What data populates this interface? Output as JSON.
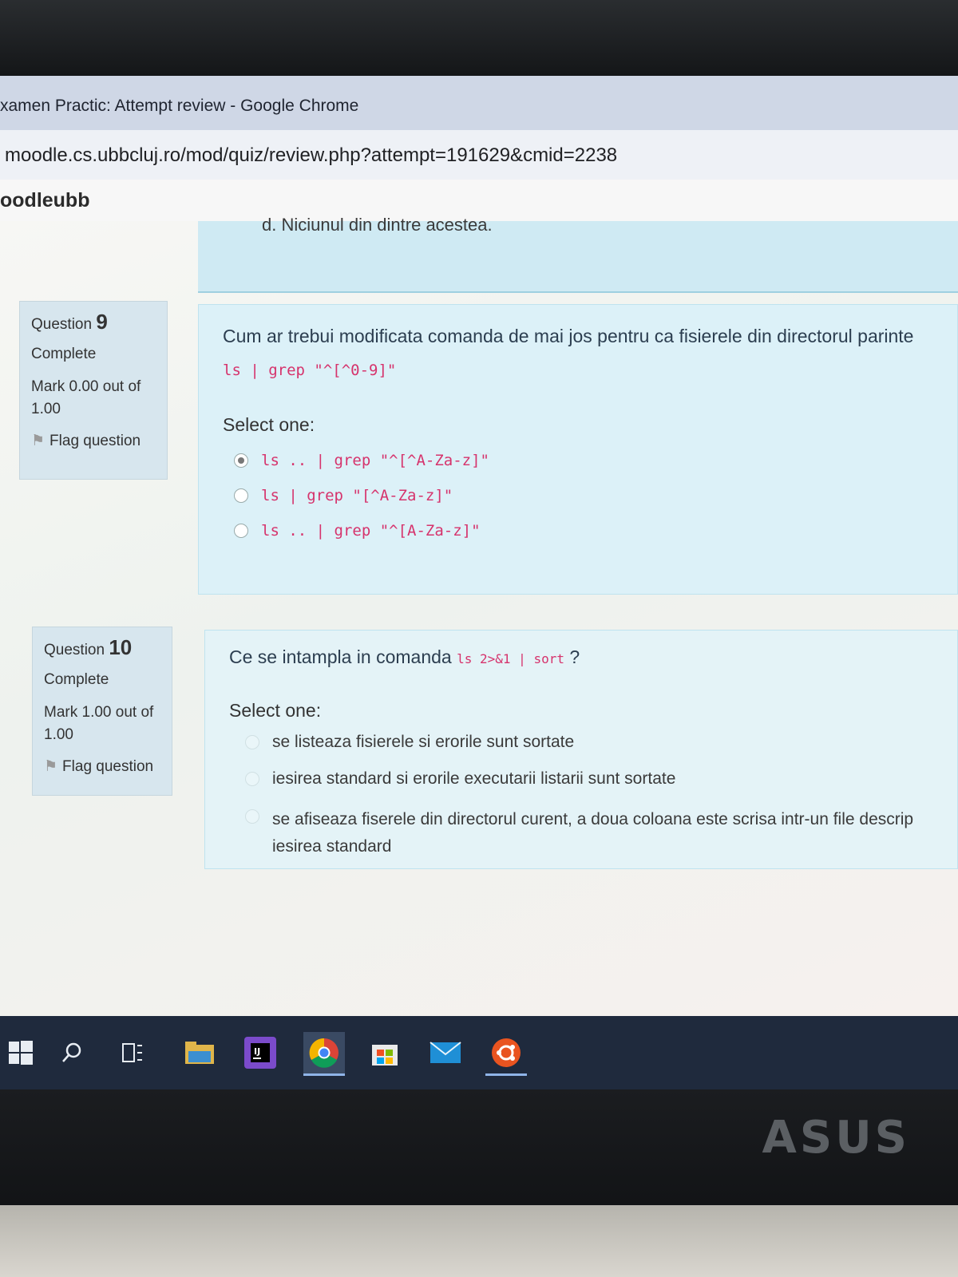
{
  "browser": {
    "window_title": "xamen Practic: Attempt review - Google Chrome",
    "url": "moodle.cs.ubbcluj.ro/mod/quiz/review.php?attempt=191629&cmid=2238"
  },
  "site": {
    "brand": "oodleubb"
  },
  "previous_question": {
    "last_option_text": "d. Niciunul din dintre acestea."
  },
  "questions": [
    {
      "label": "Question",
      "number": "9",
      "state": "Complete",
      "grade": "Mark 0.00 out of 1.00",
      "flag_label": "Flag question",
      "text": "Cum ar trebui modificata comanda de mai jos pentru ca fisierele din directorul parinte",
      "code": "ls | grep \"^[^0-9]\"",
      "prompt": "Select one:",
      "answers": [
        {
          "text": "ls .. | grep \"^[^A-Za-z]\"",
          "selected": true
        },
        {
          "text": "ls | grep \"[^A-Za-z]\"",
          "selected": false
        },
        {
          "text": "ls .. | grep \"^[A-Za-z]\"",
          "selected": false
        }
      ]
    },
    {
      "label": "Question",
      "number": "10",
      "state": "Complete",
      "grade": "Mark 1.00 out of 1.00",
      "flag_label": "Flag question",
      "text_before": "Ce se intampla in comanda",
      "code": "ls 2>&1 | sort",
      "text_after": "?",
      "prompt": "Select one:",
      "answers": [
        {
          "text": "se listeaza fisierele si erorile sunt sortate",
          "selected": false
        },
        {
          "text": "iesirea standard si erorile executarii listarii sunt sortate",
          "selected": false
        },
        {
          "text": "se afiseaza fiserele din directorul curent, a doua coloana este scrisa intr-un file descrip iesirea standard",
          "selected": false
        }
      ]
    }
  ],
  "taskbar": {
    "icons": [
      "windows-start-icon",
      "search-icon",
      "task-view-icon",
      "file-explorer-icon",
      "intellij-icon",
      "chrome-icon",
      "store-icon",
      "mail-icon",
      "ubuntu-icon"
    ]
  },
  "laptop": {
    "brand": "ASUS"
  }
}
